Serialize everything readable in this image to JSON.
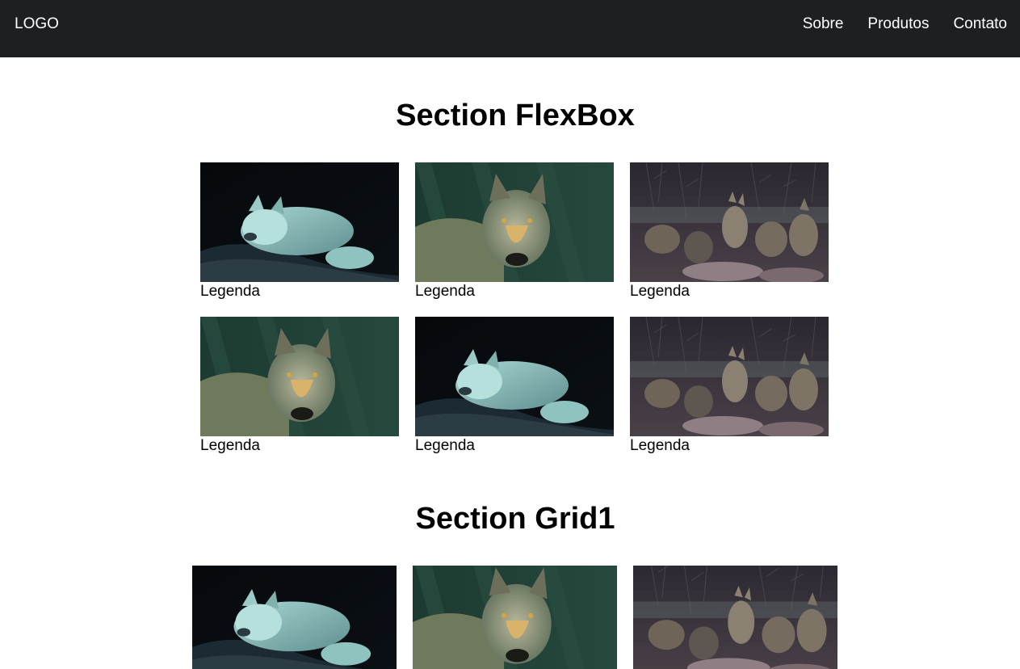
{
  "header": {
    "logo": "LOGO",
    "nav": [
      "Sobre",
      "Produtos",
      "Contato"
    ]
  },
  "flexbox_section": {
    "title": "Section FlexBox",
    "cards": [
      {
        "photo": "white-wolf-lying",
        "caption": "Legenda"
      },
      {
        "photo": "gray-wolf-portrait",
        "caption": "Legenda"
      },
      {
        "photo": "wolf-pack-in-woods",
        "caption": "Legenda"
      },
      {
        "photo": "gray-wolf-portrait",
        "caption": "Legenda"
      },
      {
        "photo": "white-wolf-lying",
        "caption": "Legenda"
      },
      {
        "photo": "wolf-pack-in-woods",
        "caption": "Legenda"
      }
    ]
  },
  "grid1_section": {
    "title": "Section Grid1",
    "items": [
      {
        "photo": "white-wolf-lying"
      },
      {
        "photo": "gray-wolf-portrait"
      },
      {
        "photo": "wolf-pack-in-woods"
      }
    ]
  },
  "colors": {
    "header_bg": "#1e1f21",
    "header_text": "#ffffff",
    "page_bg": "#ffffff"
  }
}
